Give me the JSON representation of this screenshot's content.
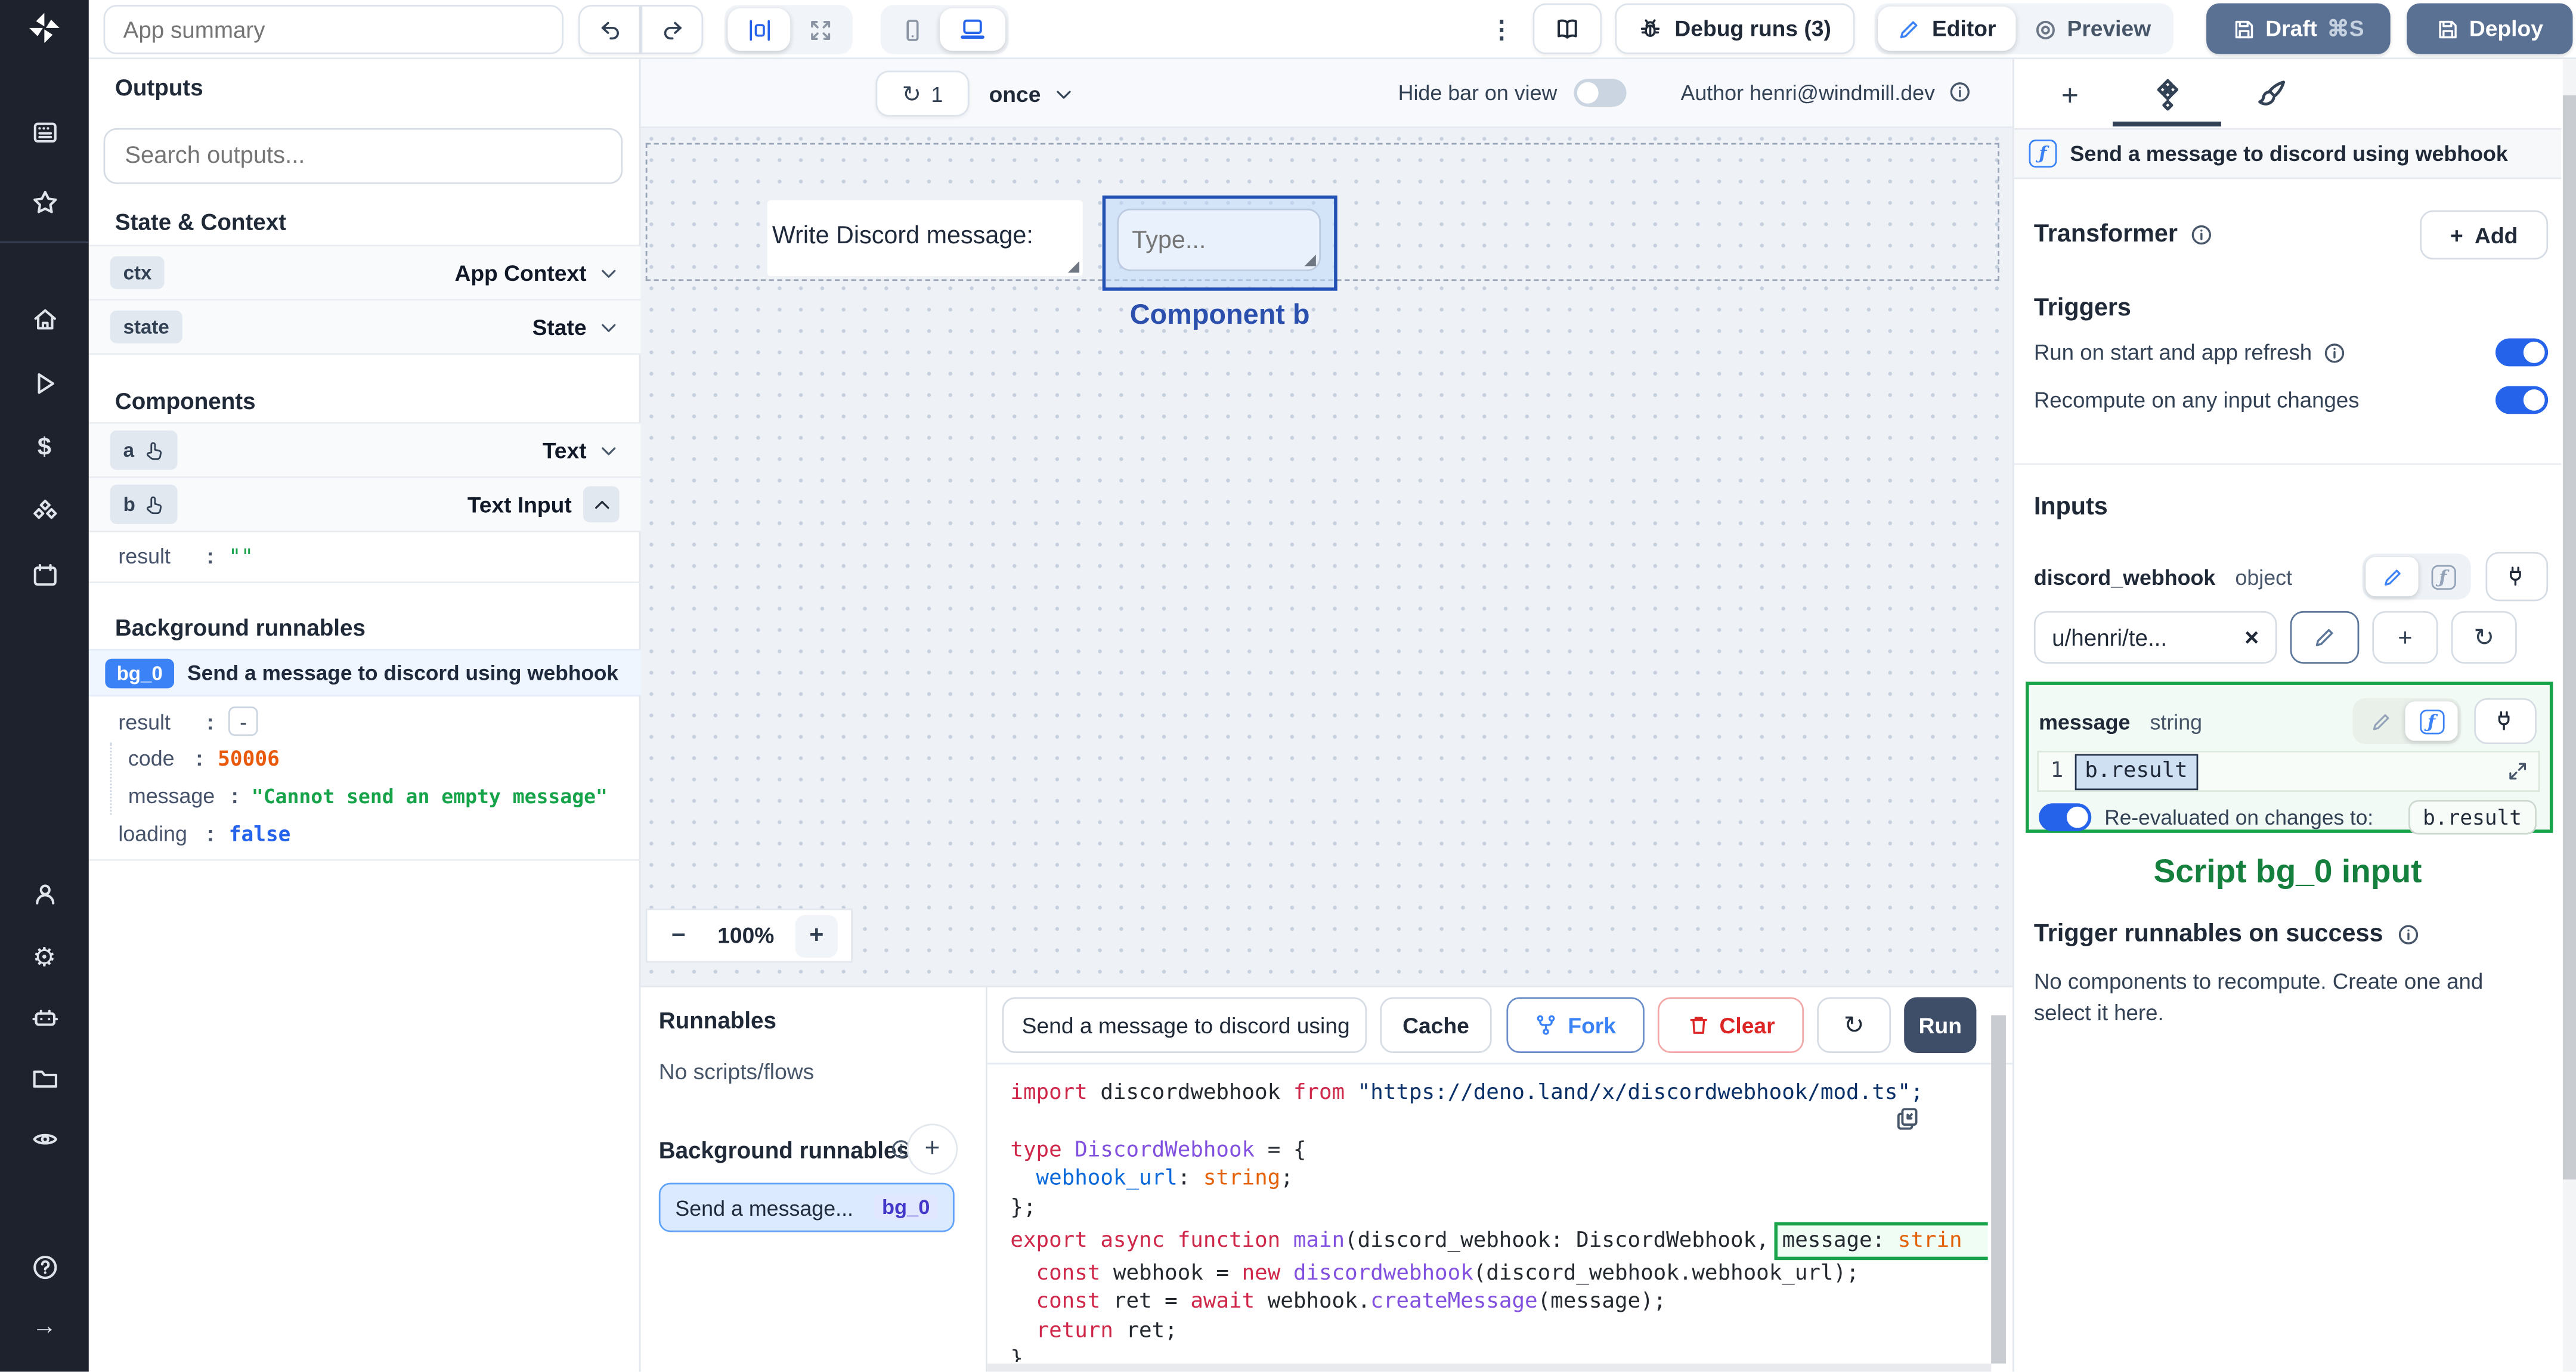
{
  "colors": {
    "accent_blue": "#2563eb",
    "annotation_green": "#15803d",
    "annotation_blue": "#2b4fad",
    "draft_button": "#5a7194",
    "run_button": "#3e4d68",
    "badge_blue": "#3b82f6",
    "error_orange": "#e8590c",
    "string_green": "#16a34a",
    "bool_blue": "#2563eb"
  },
  "topbar": {
    "app_summary_placeholder": "App summary",
    "debug_runs_label": "Debug runs (3)",
    "editor_label": "Editor",
    "preview_label": "Preview",
    "draft_label": "Draft",
    "draft_shortcut": "⌘S",
    "deploy_label": "Deploy",
    "kebab_glyph": "⋮"
  },
  "canvas_bar": {
    "refresh_glyph": "↻",
    "refresh_count": "1",
    "schedule": "once",
    "hide_bar_label": "Hide bar on view",
    "author_label": "Author henri@windmill.dev"
  },
  "outputs_panel": {
    "title": "Outputs",
    "search_placeholder": "Search outputs...",
    "state_context_title": "State & Context",
    "state_rows": [
      {
        "id": "ctx",
        "type": "App Context"
      },
      {
        "id": "state",
        "type": "State"
      }
    ],
    "components_title": "Components",
    "component_rows": [
      {
        "id": "a",
        "type": "Text"
      },
      {
        "id": "b",
        "type": "Text Input"
      }
    ],
    "b_result": {
      "key": "result",
      "colon": ":",
      "value": "\"\""
    },
    "background_title": "Background runnables",
    "bg": {
      "id": "bg_0",
      "name": "Send a message to discord using webhook",
      "result_key": "result",
      "colon": ":",
      "collapse_glyph": "-",
      "code_key": "code",
      "code_value": "50006",
      "message_key": "message",
      "message_value": "\"Cannot send an empty message\"",
      "loading_key": "loading",
      "loading_value": "false"
    }
  },
  "canvas": {
    "text_component": "Write Discord message:",
    "input_placeholder": "Type...",
    "selection_label": "Component b",
    "zoom_out": "−",
    "zoom_level": "100%",
    "zoom_in": "+"
  },
  "runnables_panel": {
    "title": "Runnables",
    "empty_label": "No scripts/flows",
    "background_title": "Background runnables",
    "add_glyph": "+",
    "item": {
      "name": "Send a message...",
      "id": "bg_0"
    }
  },
  "editor_panel": {
    "script_name": "Send a message to discord using",
    "cache_label": "Cache",
    "fork_label": "Fork",
    "clear_label": "Clear",
    "refresh_glyph": "↻",
    "run_label": "Run",
    "code_lines": [
      [
        {
          "t": "import ",
          "c": "k"
        },
        {
          "t": "discordwebhook ",
          "c": "d"
        },
        {
          "t": "from ",
          "c": "k"
        },
        {
          "t": "\"https://deno.land/x/discordwebhook/mod.ts\";",
          "c": "s"
        }
      ],
      [],
      [
        {
          "t": "type ",
          "c": "k"
        },
        {
          "t": "DiscordWebhook ",
          "c": "p"
        },
        {
          "t": "= {",
          "c": "d"
        }
      ],
      [
        {
          "t": "  ",
          "c": "d"
        },
        {
          "t": "webhook_url",
          "c": "b"
        },
        {
          "t": ": ",
          "c": "d"
        },
        {
          "t": "string",
          "c": "o"
        },
        {
          "t": ";",
          "c": "d"
        }
      ],
      [
        {
          "t": "};",
          "c": "d"
        }
      ],
      [
        {
          "t": "export async function ",
          "c": "k"
        },
        {
          "t": "main",
          "c": "p"
        },
        {
          "t": "(discord_webhook: DiscordWebhook,",
          "c": "d"
        },
        {
          "t": "message: ",
          "c": "d",
          "box": true
        },
        {
          "t": "strin",
          "c": "o",
          "box": true
        }
      ],
      [
        {
          "t": "  ",
          "c": "d"
        },
        {
          "t": "const ",
          "c": "k"
        },
        {
          "t": "webhook = ",
          "c": "d"
        },
        {
          "t": "new ",
          "c": "k"
        },
        {
          "t": "discordwebhook",
          "c": "p"
        },
        {
          "t": "(discord_webhook.webhook_url);",
          "c": "d"
        }
      ],
      [
        {
          "t": "  ",
          "c": "d"
        },
        {
          "t": "const ",
          "c": "k"
        },
        {
          "t": "ret = ",
          "c": "d"
        },
        {
          "t": "await ",
          "c": "k"
        },
        {
          "t": "webhook.",
          "c": "d"
        },
        {
          "t": "createMessage",
          "c": "p"
        },
        {
          "t": "(message);",
          "c": "d"
        }
      ],
      [
        {
          "t": "  ",
          "c": "d"
        },
        {
          "t": "return ",
          "c": "k"
        },
        {
          "t": "ret;",
          "c": "d"
        }
      ],
      [
        {
          "t": "}",
          "c": "d"
        }
      ]
    ]
  },
  "settings_panel": {
    "header": "Send a message to discord using webhook",
    "fn_glyph": "ƒ",
    "transformer_label": "Transformer",
    "add_label": "Add",
    "add_plus": "+",
    "triggers_title": "Triggers",
    "trigger_rows": [
      "Run on start and app refresh",
      "Recompute on any input changes"
    ],
    "inputs_title": "Inputs",
    "discord_webhook": {
      "name": "discord_webhook",
      "type": "object",
      "value": "u/henri/te...",
      "clear_glyph": "×",
      "plus_glyph": "+",
      "refresh_glyph": "↻"
    },
    "message_input": {
      "name": "message",
      "type": "string",
      "line_number": "1",
      "expr": "b.result",
      "reeval_label": "Re-evaluated on changes to:",
      "reeval_target": "b.result"
    },
    "annotation": "Script bg_0 input",
    "success_title": "Trigger runnables on success",
    "success_body": "No components to recompute. Create one and select it here."
  }
}
